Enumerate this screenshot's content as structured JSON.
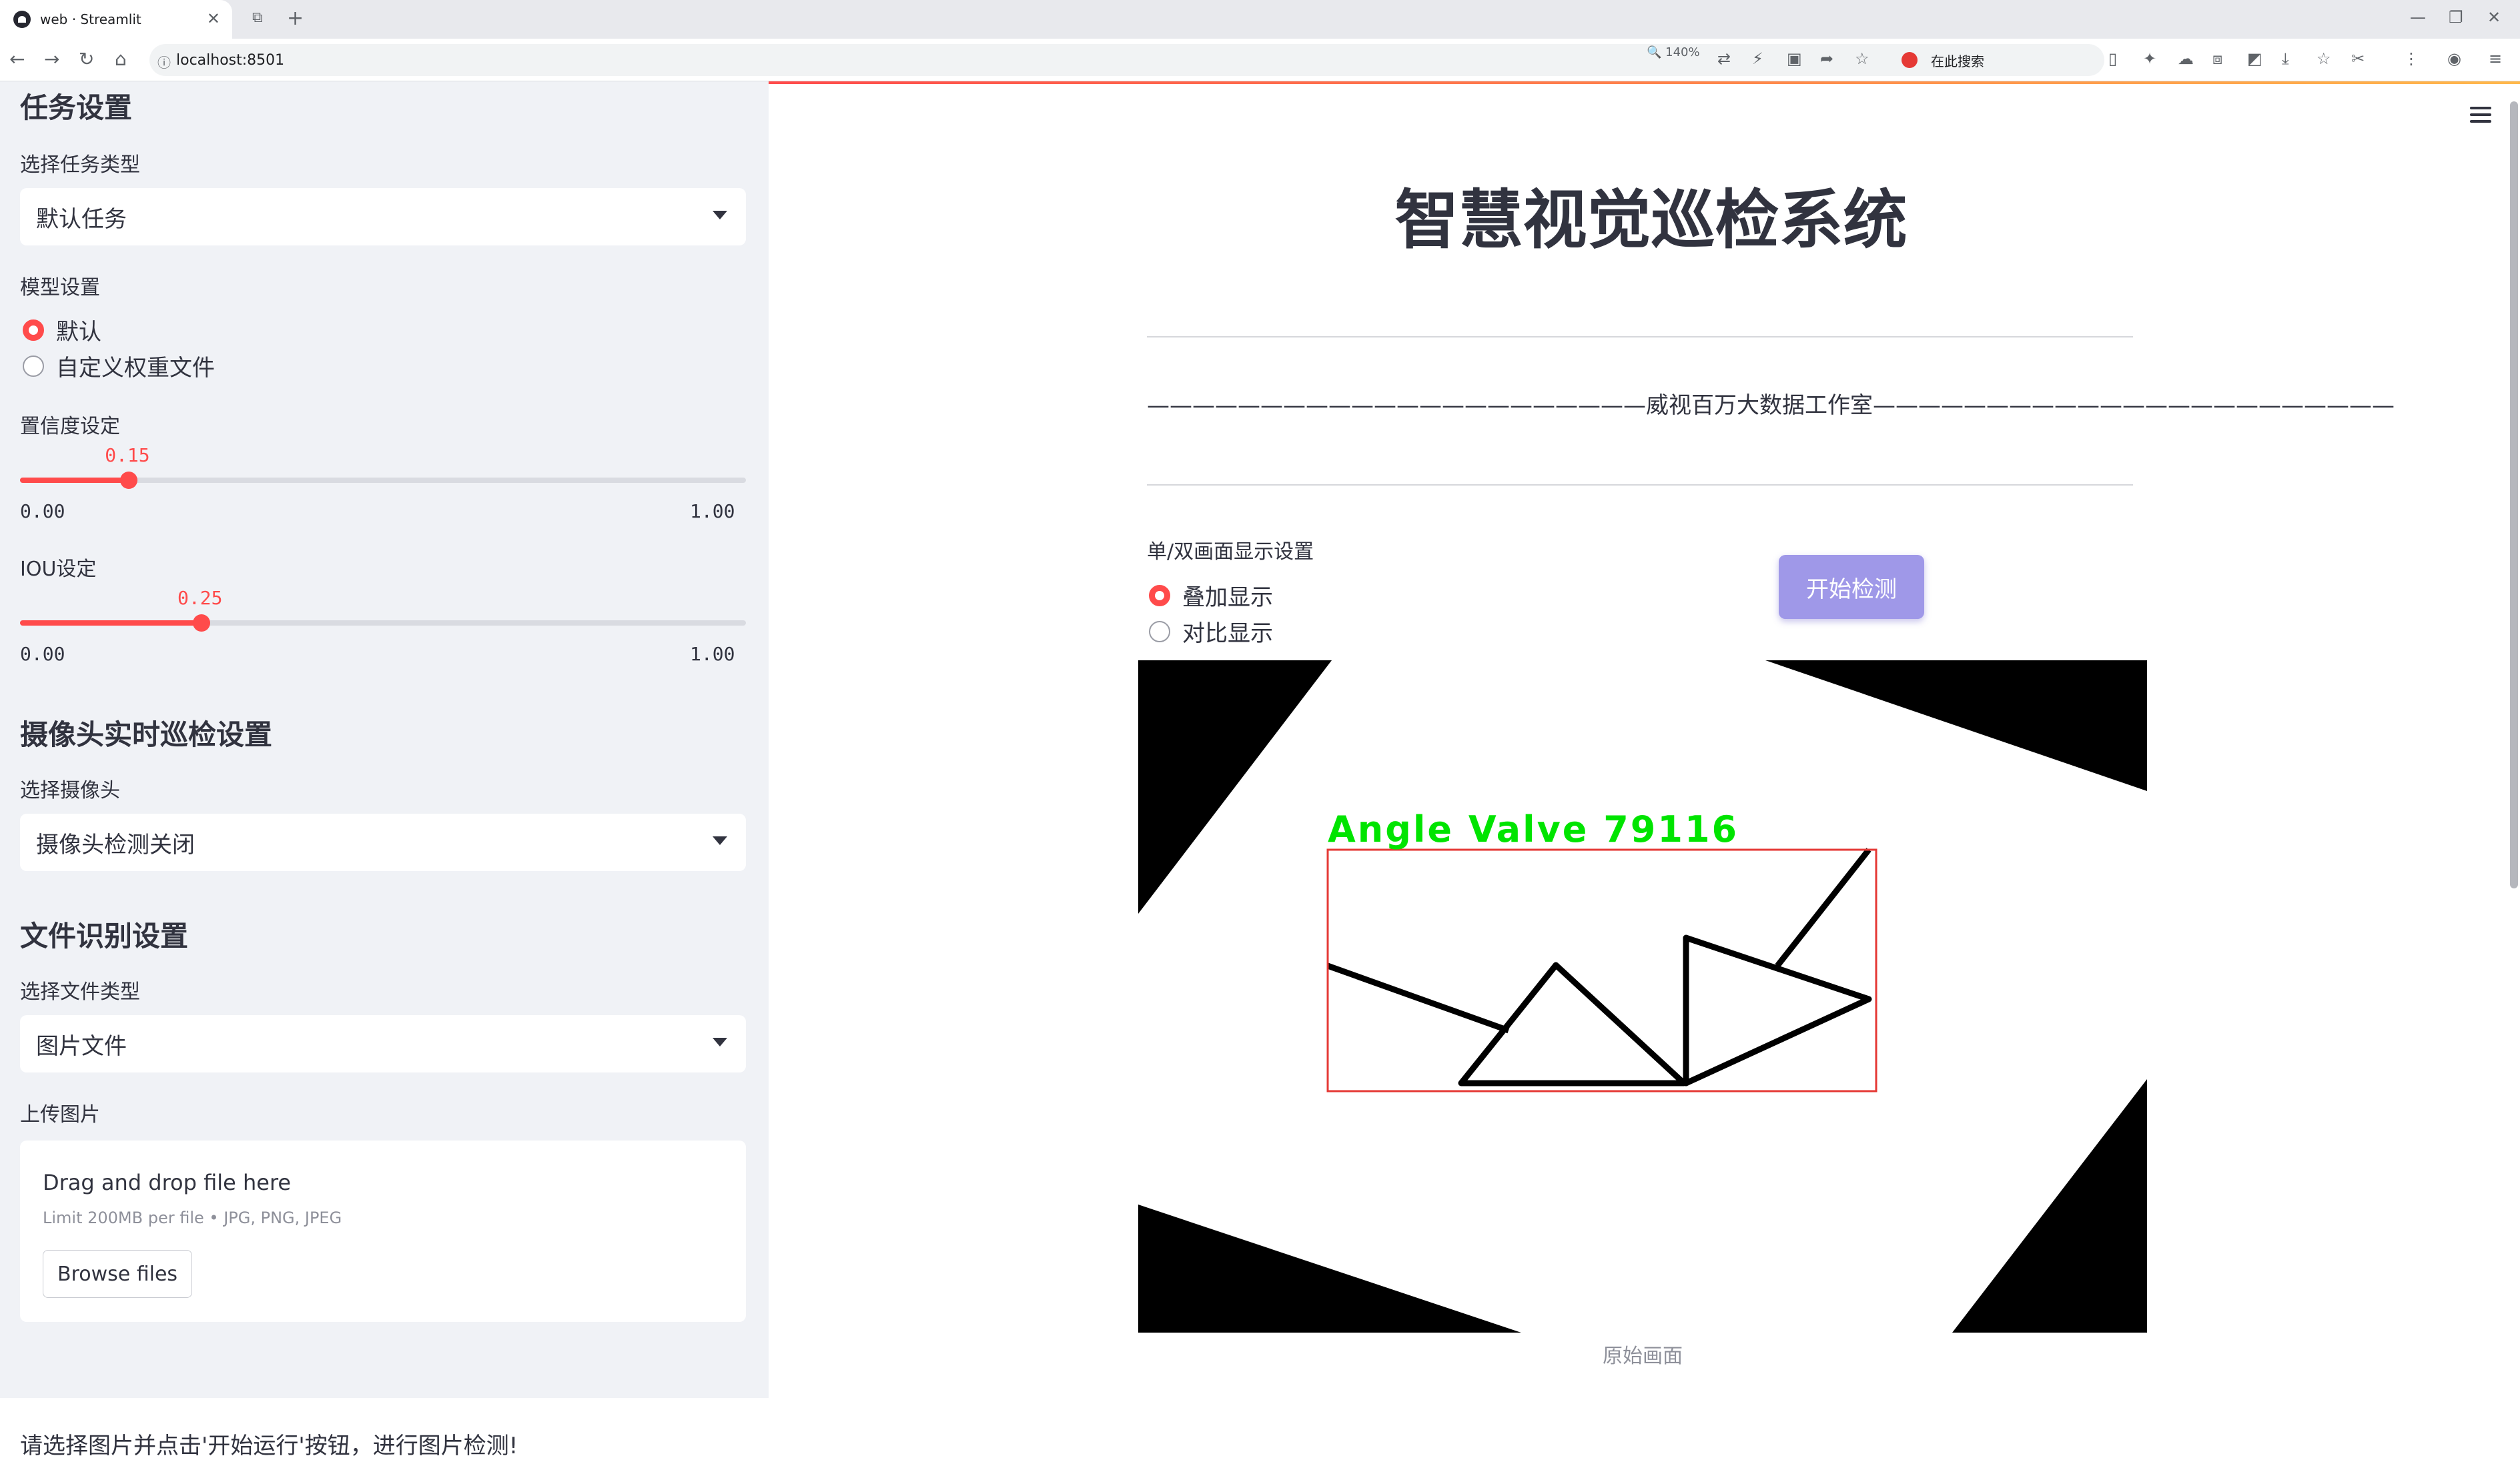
{
  "browser": {
    "tab_title": "web · Streamlit",
    "url": "localhost:8501",
    "zoom": "140%",
    "search_placeholder": "在此搜索"
  },
  "sidebar": {
    "task_header": "任务设置",
    "task_type_label": "选择任务类型",
    "task_type_value": "默认任务",
    "model_label": "模型设置",
    "model_options": [
      "默认",
      "自定义权重文件"
    ],
    "model_selected": 0,
    "confidence": {
      "label": "置信度设定",
      "value": "0.15",
      "min": "0.00",
      "max": "1.00",
      "fraction": 0.15
    },
    "iou": {
      "label": "IOU设定",
      "value": "0.25",
      "min": "0.00",
      "max": "1.00",
      "fraction": 0.25
    },
    "camera_header": "摄像头实时巡检设置",
    "camera_label": "选择摄像头",
    "camera_value": "摄像头检测关闭",
    "file_header": "文件识别设置",
    "file_type_label": "选择文件类型",
    "file_type_value": "图片文件",
    "upload_label": "上传图片",
    "upload": {
      "title": "Drag and drop file here",
      "limit": "Limit 200MB per file • JPG, PNG, JPEG",
      "button": "Browse files"
    },
    "note": "请选择图片并点击'开始运行'按钮，进行图片检测!"
  },
  "main": {
    "title": "智慧视觉巡检系统",
    "studio": "——————————————————————威视百万大数据工作室———————————————————————",
    "display_label": "单/双画面显示设置",
    "display_options": [
      "叠加显示",
      "对比显示"
    ],
    "display_selected": 0,
    "start_button": "开始检测",
    "detection_label": "Angle Valve 79116",
    "detection_color": "#00e400",
    "box_color": "#e53935",
    "caption": "原始画面"
  }
}
